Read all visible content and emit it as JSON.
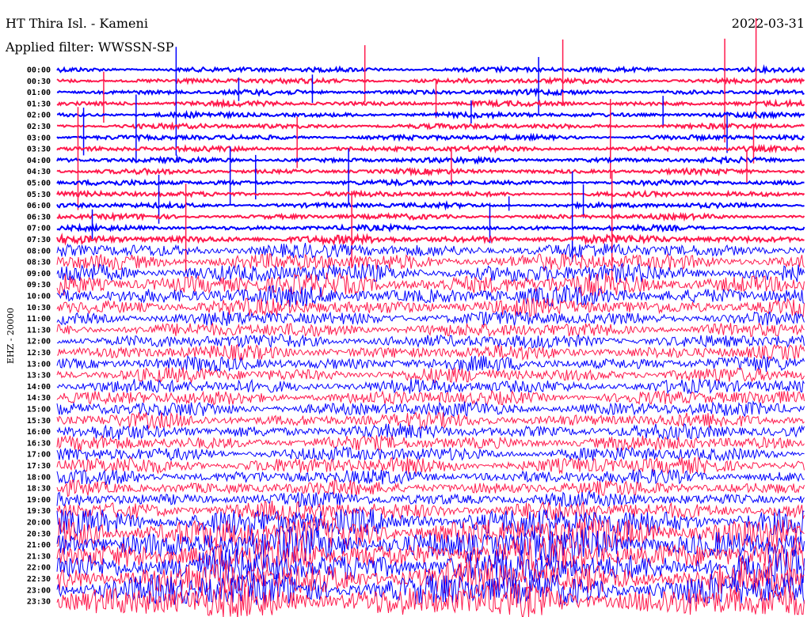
{
  "header": {
    "station": "HT Thira Isl. - Kameni",
    "filter": "Applied filter: WWSSN-SP",
    "date": "2022-03-31"
  },
  "chart_data": {
    "type": "line",
    "subtype": "helicorder",
    "ylabel": "EHZ - 20000",
    "colors": [
      "#0000ff",
      "#ff1a4d"
    ],
    "row_minutes": 30,
    "rows": [
      "00:00",
      "00:30",
      "01:00",
      "01:30",
      "02:00",
      "02:30",
      "03:00",
      "03:30",
      "04:00",
      "04:30",
      "05:00",
      "05:30",
      "06:00",
      "06:30",
      "07:00",
      "07:30",
      "08:00",
      "08:30",
      "09:00",
      "09:30",
      "10:00",
      "10:30",
      "11:00",
      "11:30",
      "12:00",
      "12:30",
      "13:00",
      "13:30",
      "14:00",
      "14:30",
      "15:00",
      "15:30",
      "16:00",
      "16:30",
      "17:00",
      "17:30",
      "18:00",
      "18:30",
      "19:00",
      "19:30",
      "20:00",
      "20:30",
      "21:00",
      "21:30",
      "22:00",
      "22:30",
      "23:00",
      "23:30"
    ],
    "relative_amplitude": [
      1,
      1,
      1,
      1,
      1,
      1,
      1,
      1,
      1,
      1,
      1,
      1,
      1,
      1,
      1,
      1.5,
      3,
      3.5,
      4,
      4.5,
      4,
      3.5,
      3,
      3,
      3,
      3,
      3,
      3,
      3,
      3,
      3,
      3,
      3,
      3,
      3,
      3.5,
      3,
      3,
      3,
      4,
      6,
      7,
      7,
      7,
      7,
      7,
      7,
      7
    ]
  }
}
